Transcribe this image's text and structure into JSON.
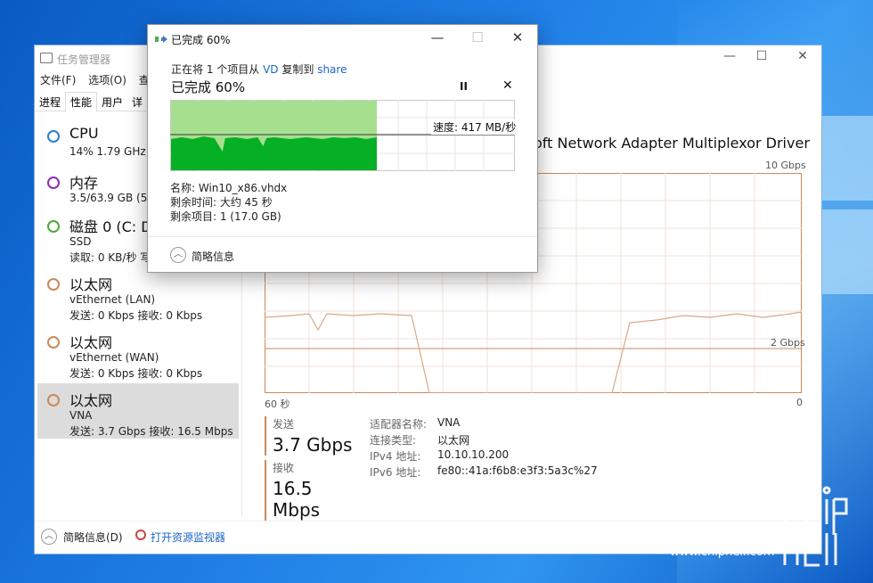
{
  "taskmgr": {
    "title": "任务管理器",
    "controls": {
      "minimize": "—",
      "maximize": "☐",
      "close": "✕"
    },
    "menu": [
      "文件(F)",
      "选项(O)",
      "查"
    ],
    "tabs": [
      "进程",
      "性能",
      "用户",
      "详"
    ],
    "sidebar": [
      {
        "name": "CPU",
        "line2": "14%  1.79 GHz",
        "line3": "",
        "color": "#2a7fd4"
      },
      {
        "name": "内存",
        "line2": "3.5/63.9 GB (5%",
        "line3": "",
        "color": "#8b2fb5"
      },
      {
        "name": "磁盘 0 (C: D:",
        "line2": "SSD",
        "line3": "读取: 0 KB/秒  写",
        "color": "#4fa83b"
      },
      {
        "name": "以太网",
        "line2": "vEthernet (LAN)",
        "line3": "发送: 0 Kbps  接收: 0 Kbps",
        "color": "#c98a5a"
      },
      {
        "name": "以太网",
        "line2": "vEthernet (WAN)",
        "line3": "发送: 0 Kbps  接收: 0 Kbps",
        "color": "#c98a5a"
      },
      {
        "name": "以太网",
        "line2": "VNA",
        "line3": "发送: 3.7 Gbps  接收: 16.5 Mbps",
        "color": "#c98a5a"
      }
    ],
    "adapter_name": "oft Network Adapter Multiplexor Driver",
    "graph": {
      "max_label": "10 Gbps",
      "mid_label": "2 Gbps",
      "left_label": "60 秒",
      "right_label": "0",
      "line_color": "#c98a5a"
    },
    "send": {
      "label": "发送",
      "value": "3.7 Gbps"
    },
    "recv": {
      "label": "接收",
      "value": "16.5 Mbps"
    },
    "info": [
      {
        "k": "适配器名称:",
        "v": "VNA"
      },
      {
        "k": "连接类型:",
        "v": "以太网"
      },
      {
        "k": "IPv4 地址:",
        "v": "10.10.10.200"
      },
      {
        "k": "IPv6 地址:",
        "v": "fe80::41a:f6b8:e3f3:5a3c%27"
      }
    ],
    "footer": {
      "brief": "简略信息(D)",
      "link": "打开资源监视器"
    }
  },
  "dialog": {
    "title": "已完成 60%",
    "controls": {
      "minimize": "—",
      "maximize": "☐",
      "close": "✕"
    },
    "desc_pre": "正在将 1 个项目从 ",
    "src": "VD",
    "desc_mid": " 复制到 ",
    "dst": "share",
    "heading": "已完成 60%",
    "pause": "II",
    "stop": "✕",
    "progress": 0.6,
    "speed": "速度: 417 MB/秒",
    "name": "名称:  Win10_x86.vhdx",
    "remaining_time": "剩余时间:  大约 45 秒",
    "remaining_items": "剩余项目:  1 (17.0 GB)",
    "less_details": "简略信息",
    "accent": "#06b025"
  },
  "watermark": "www.chiphell.com"
}
